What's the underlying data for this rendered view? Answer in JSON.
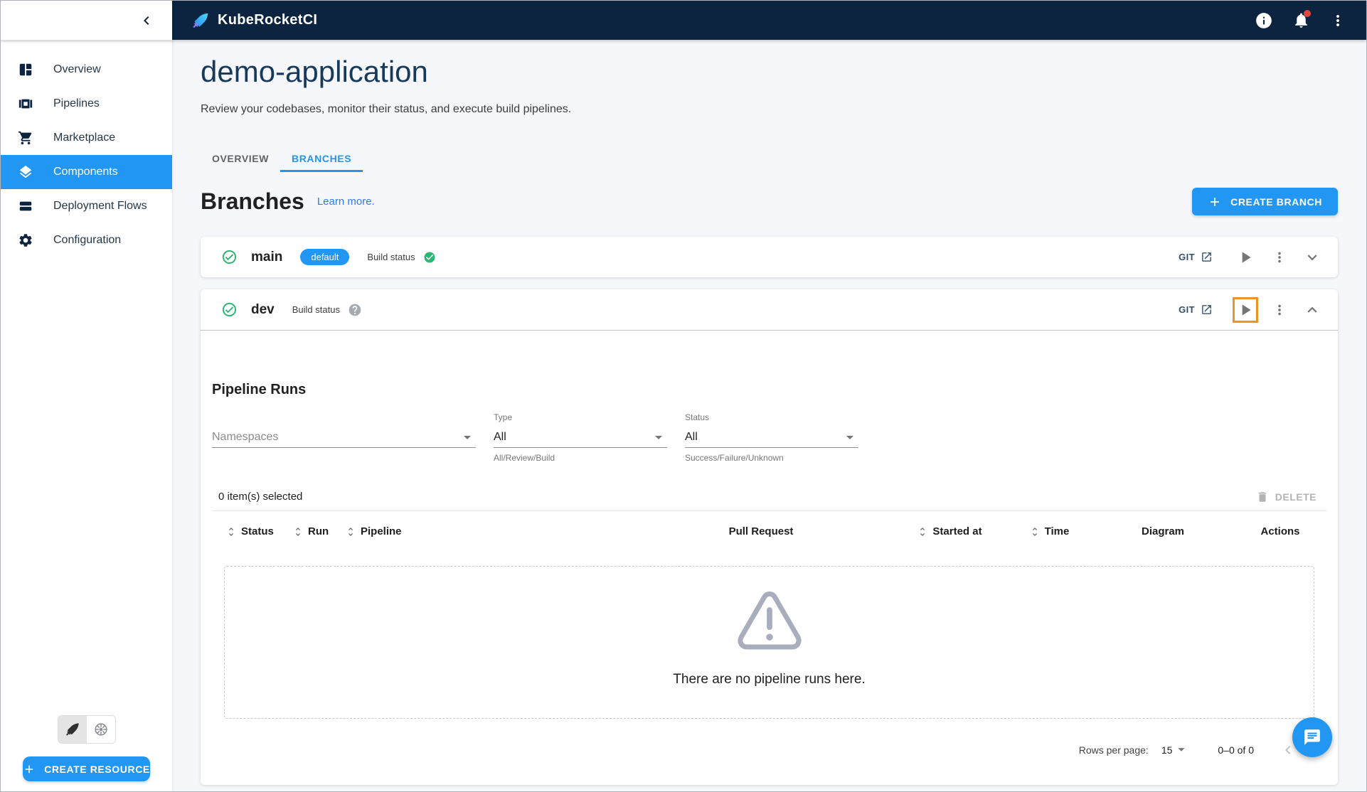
{
  "topbar": {
    "brand": "KubeRocketCI"
  },
  "sidebar": {
    "items": [
      {
        "label": "Overview"
      },
      {
        "label": "Pipelines"
      },
      {
        "label": "Marketplace"
      },
      {
        "label": "Components"
      },
      {
        "label": "Deployment Flows"
      },
      {
        "label": "Configuration"
      }
    ],
    "create_resource_label": "CREATE RESOURCE"
  },
  "page": {
    "title": "demo-application",
    "subtitle": "Review your codebases, monitor their status, and execute build pipelines."
  },
  "tabs": {
    "overview": "OVERVIEW",
    "branches": "BRANCHES"
  },
  "branches_section": {
    "heading": "Branches",
    "learn_more": "Learn more.",
    "create_button": "CREATE BRANCH"
  },
  "branch_main": {
    "name": "main",
    "chip": "default",
    "build_status": "Build status",
    "git": "GIT"
  },
  "branch_dev": {
    "name": "dev",
    "build_status": "Build status",
    "git": "GIT"
  },
  "pipeline_runs": {
    "heading": "Pipeline Runs",
    "namespaces_placeholder": "Namespaces",
    "type_label": "Type",
    "type_value": "All",
    "type_helper": "All/Review/Build",
    "status_label": "Status",
    "status_value": "All",
    "status_helper": "Success/Failure/Unknown",
    "selected_text": "0 item(s) selected",
    "delete_label": "DELETE",
    "headers": [
      "Status",
      "Run",
      "Pipeline",
      "Pull Request",
      "Started at",
      "Time",
      "Diagram",
      "Actions"
    ],
    "empty_message": "There are no pipeline runs here.",
    "rows_per_page_label": "Rows per page:",
    "rows_per_page_value": "15",
    "range_text": "0–0 of 0"
  },
  "colors": {
    "accent": "#2196f3",
    "topbar_bg": "#0c2440",
    "success_green": "#2bb673",
    "highlight_orange": "#f0941f",
    "empty_icon_gray": "#a8aebc"
  }
}
